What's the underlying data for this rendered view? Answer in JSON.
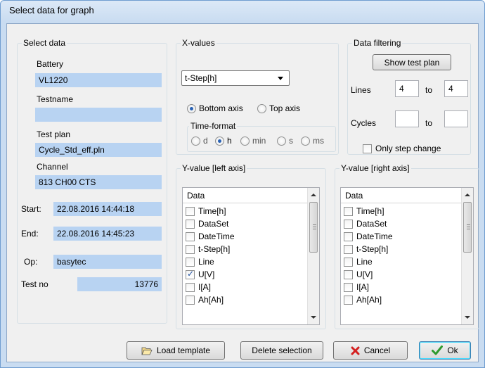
{
  "window": {
    "title": "Select data for graph"
  },
  "select_data": {
    "legend": "Select data",
    "battery_label": "Battery",
    "battery_value": "VL1220",
    "testname_label": "Testname",
    "testname_value": "",
    "testplan_label": "Test plan",
    "testplan_value": "Cycle_Std_eff.pln",
    "channel_label": "Channel",
    "channel_value": "813 CH00 CTS",
    "start_label": "Start:",
    "start_value": "22.08.2016 14:44:18",
    "end_label": "End:",
    "end_value": "22.08.2016 14:45:23",
    "op_label": "Op:",
    "op_value": "basytec",
    "testno_label": "Test no",
    "testno_value": "13776"
  },
  "x_values": {
    "legend": "X-values",
    "combo_value": "t-Step[h]",
    "axis_options": [
      {
        "label": "Bottom axis",
        "selected": true
      },
      {
        "label": "Top axis",
        "selected": false
      }
    ],
    "time_format_legend": "Time-format",
    "time_formats": [
      {
        "label": "d",
        "selected": false
      },
      {
        "label": "h",
        "selected": true
      },
      {
        "label": "min",
        "selected": false
      },
      {
        "label": "s",
        "selected": false
      },
      {
        "label": "ms",
        "selected": false
      }
    ]
  },
  "data_filtering": {
    "legend": "Data filtering",
    "show_test_plan": "Show test plan",
    "lines_label": "Lines",
    "lines_from": "4",
    "to_label": "to",
    "lines_to": "4",
    "cycles_label": "Cycles",
    "cycles_from": "",
    "cycles_to": "",
    "only_step_change": "Only step change",
    "only_step_change_checked": false
  },
  "y_left": {
    "legend": "Y-value [left axis]",
    "header": "Data",
    "items": [
      {
        "label": "Time[h]",
        "checked": false
      },
      {
        "label": "DataSet",
        "checked": false
      },
      {
        "label": "DateTime",
        "checked": false
      },
      {
        "label": "t-Step[h]",
        "checked": false
      },
      {
        "label": "Line",
        "checked": false
      },
      {
        "label": "U[V]",
        "checked": true
      },
      {
        "label": "I[A]",
        "checked": false
      },
      {
        "label": "Ah[Ah]",
        "checked": false
      }
    ]
  },
  "y_right": {
    "legend": "Y-value [right axis]",
    "header": "Data",
    "items": [
      {
        "label": "Time[h]",
        "checked": false
      },
      {
        "label": "DataSet",
        "checked": false
      },
      {
        "label": "DateTime",
        "checked": false
      },
      {
        "label": "t-Step[h]",
        "checked": false
      },
      {
        "label": "Line",
        "checked": false
      },
      {
        "label": "U[V]",
        "checked": false
      },
      {
        "label": "I[A]",
        "checked": false
      },
      {
        "label": "Ah[Ah]",
        "checked": false
      }
    ]
  },
  "buttons": {
    "load_template": "Load template",
    "delete_selection": "Delete selection",
    "cancel": "Cancel",
    "ok": "Ok"
  },
  "icons": {
    "load_template": "folder-open-icon",
    "cancel": "red-x-icon",
    "ok": "green-check-icon"
  },
  "colors": {
    "value_field_bg": "#b8d3f2",
    "cancel_icon": "#d42020",
    "ok_icon": "#2e9a2e"
  }
}
